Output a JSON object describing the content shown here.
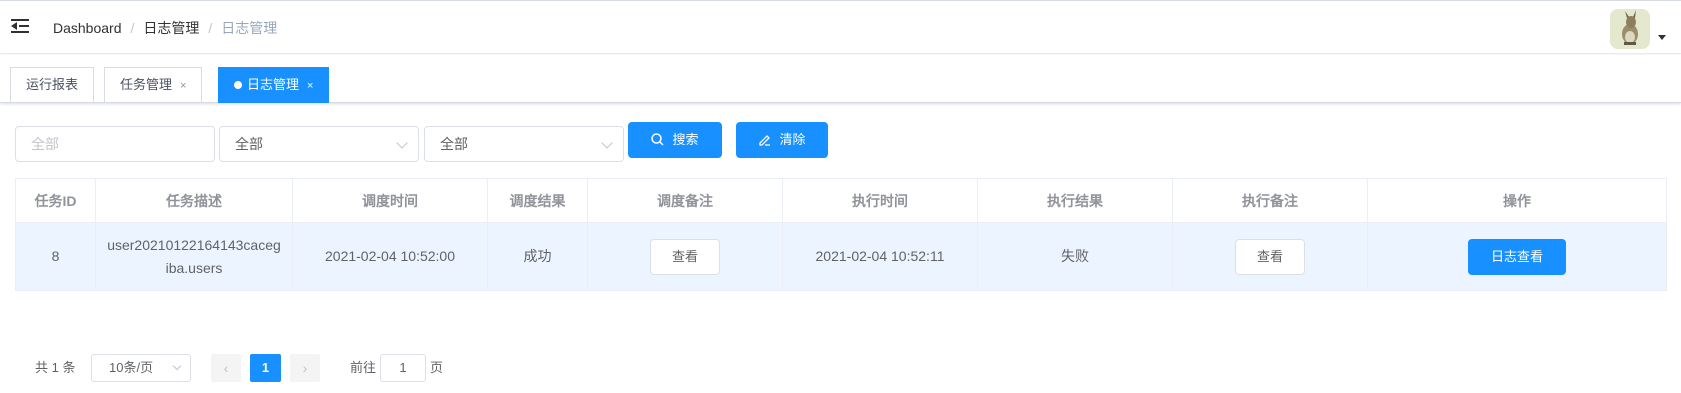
{
  "header": {
    "breadcrumb": [
      "Dashboard",
      "日志管理",
      "日志管理"
    ],
    "separator": "/"
  },
  "tabs": [
    {
      "label": "运行报表",
      "active": false,
      "closable": false
    },
    {
      "label": "任务管理",
      "active": false,
      "closable": true
    },
    {
      "label": "日志管理",
      "active": true,
      "closable": true
    }
  ],
  "tab_close_glyph": "×",
  "filters": {
    "task_id_placeholder": "全部",
    "select1_value": "全部",
    "select2_value": "全部",
    "search_label": "搜索",
    "clear_label": "清除"
  },
  "table": {
    "columns": [
      "任务ID",
      "任务描述",
      "调度时间",
      "调度结果",
      "调度备注",
      "执行时间",
      "执行结果",
      "执行备注",
      "操作"
    ],
    "rows": [
      {
        "id": "8",
        "desc_line1": "user20210122164143caceg",
        "desc_line2": "iba.users",
        "schedule_time": "2021-02-04 10:52:00",
        "schedule_result": "成功",
        "schedule_note_btn": "查看",
        "exec_time": "2021-02-04 10:52:11",
        "exec_result": "失败",
        "exec_note_btn": "查看",
        "action_btn": "日志查看"
      }
    ]
  },
  "pagination": {
    "total": "共 1 条",
    "page_size": "10条/页",
    "current_page": "1",
    "goto_prefix": "前往",
    "goto_value": "1",
    "goto_suffix": "页"
  },
  "colors": {
    "primary": "#1890ff",
    "fail": "#ff0000",
    "row_highlight": "#ecf5ff"
  }
}
